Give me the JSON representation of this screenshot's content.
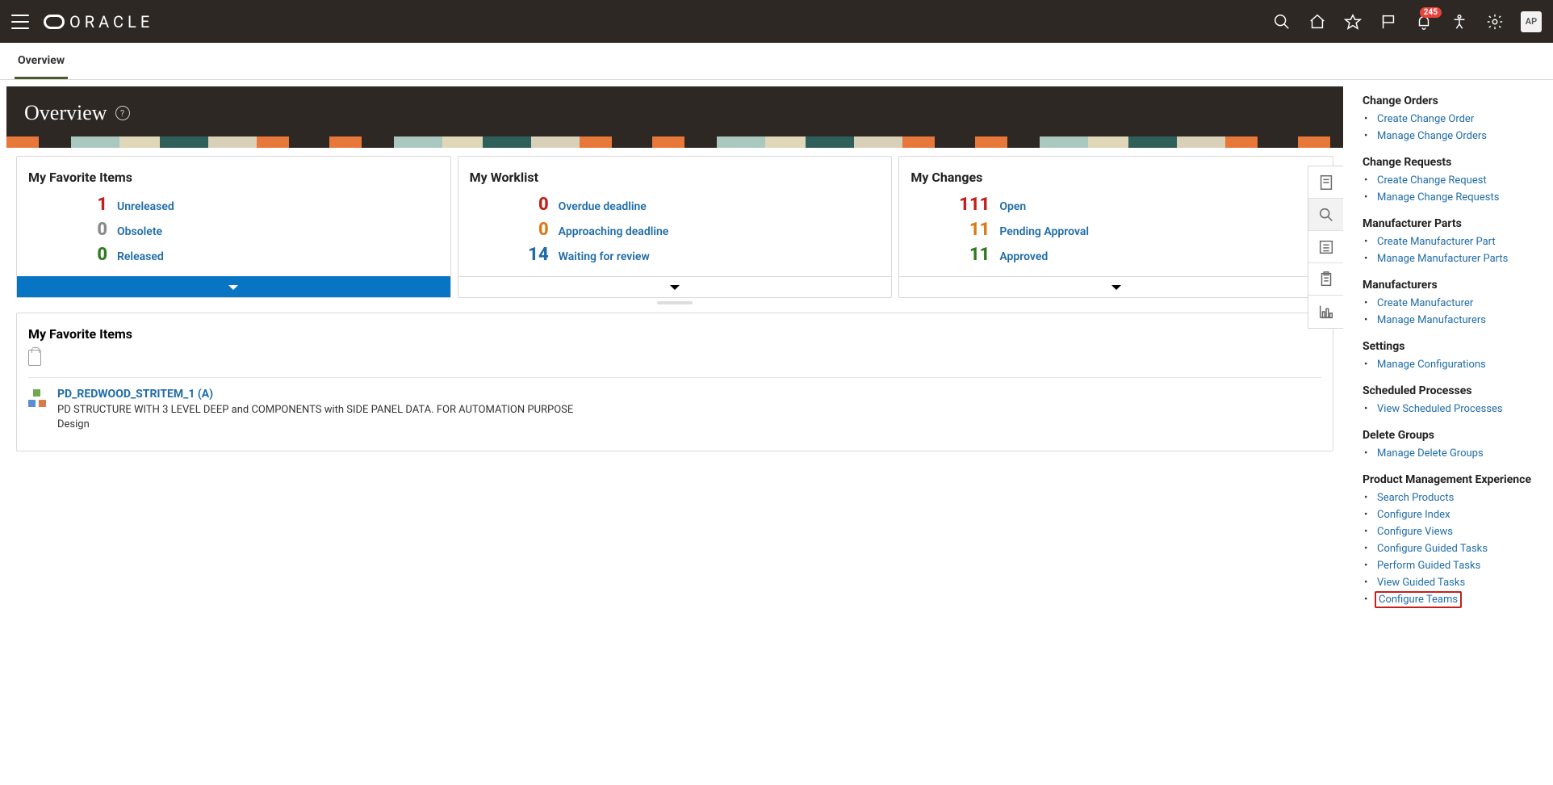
{
  "header": {
    "brand": "ORACLE",
    "notification_count": "245",
    "avatar_initials": "AP"
  },
  "tabs": {
    "active": "Overview"
  },
  "page": {
    "title": "Overview"
  },
  "cards": {
    "favorites": {
      "title": "My Favorite Items",
      "rows": [
        {
          "num": "1",
          "cls": "num-red",
          "label": "Unreleased"
        },
        {
          "num": "0",
          "cls": "num-gray",
          "label": "Obsolete"
        },
        {
          "num": "0",
          "cls": "num-green",
          "label": "Released"
        }
      ]
    },
    "worklist": {
      "title": "My Worklist",
      "rows": [
        {
          "num": "0",
          "cls": "num-red",
          "label": "Overdue deadline"
        },
        {
          "num": "0",
          "cls": "num-orange",
          "label": "Approaching deadline"
        },
        {
          "num": "14",
          "cls": "num-blue",
          "label": "Waiting for review"
        }
      ]
    },
    "changes": {
      "title": "My Changes",
      "rows": [
        {
          "num": "111",
          "cls": "num-red",
          "label": "Open"
        },
        {
          "num": "11",
          "cls": "num-orange",
          "label": "Pending Approval"
        },
        {
          "num": "11",
          "cls": "num-green",
          "label": "Approved"
        }
      ]
    }
  },
  "detail": {
    "title": "My Favorite Items",
    "item": {
      "name": "PD_REDWOOD_STRITEM_1 (A)",
      "desc_line1": "PD STRUCTURE WITH 3 LEVEL DEEP and COMPONENTS with SIDE PANEL DATA. FOR AUTOMATION PURPOSE",
      "desc_line2": "Design"
    }
  },
  "sidebar": [
    {
      "title": "Change Orders",
      "links": [
        "Create Change Order",
        "Manage Change Orders"
      ]
    },
    {
      "title": "Change Requests",
      "links": [
        "Create Change Request",
        "Manage Change Requests"
      ]
    },
    {
      "title": "Manufacturer Parts",
      "links": [
        "Create Manufacturer Part",
        "Manage Manufacturer Parts"
      ]
    },
    {
      "title": "Manufacturers",
      "links": [
        "Create Manufacturer",
        "Manage Manufacturers"
      ]
    },
    {
      "title": "Settings",
      "links": [
        "Manage Configurations"
      ]
    },
    {
      "title": "Scheduled Processes",
      "links": [
        "View Scheduled Processes"
      ]
    },
    {
      "title": "Delete Groups",
      "links": [
        "Manage Delete Groups"
      ]
    },
    {
      "title": "Product Management Experience",
      "links": [
        "Search Products",
        "Configure Index",
        "Configure Views",
        "Configure Guided Tasks",
        "Perform Guided Tasks",
        "View Guided Tasks",
        "Configure Teams"
      ],
      "highlight": "Configure Teams"
    }
  ]
}
